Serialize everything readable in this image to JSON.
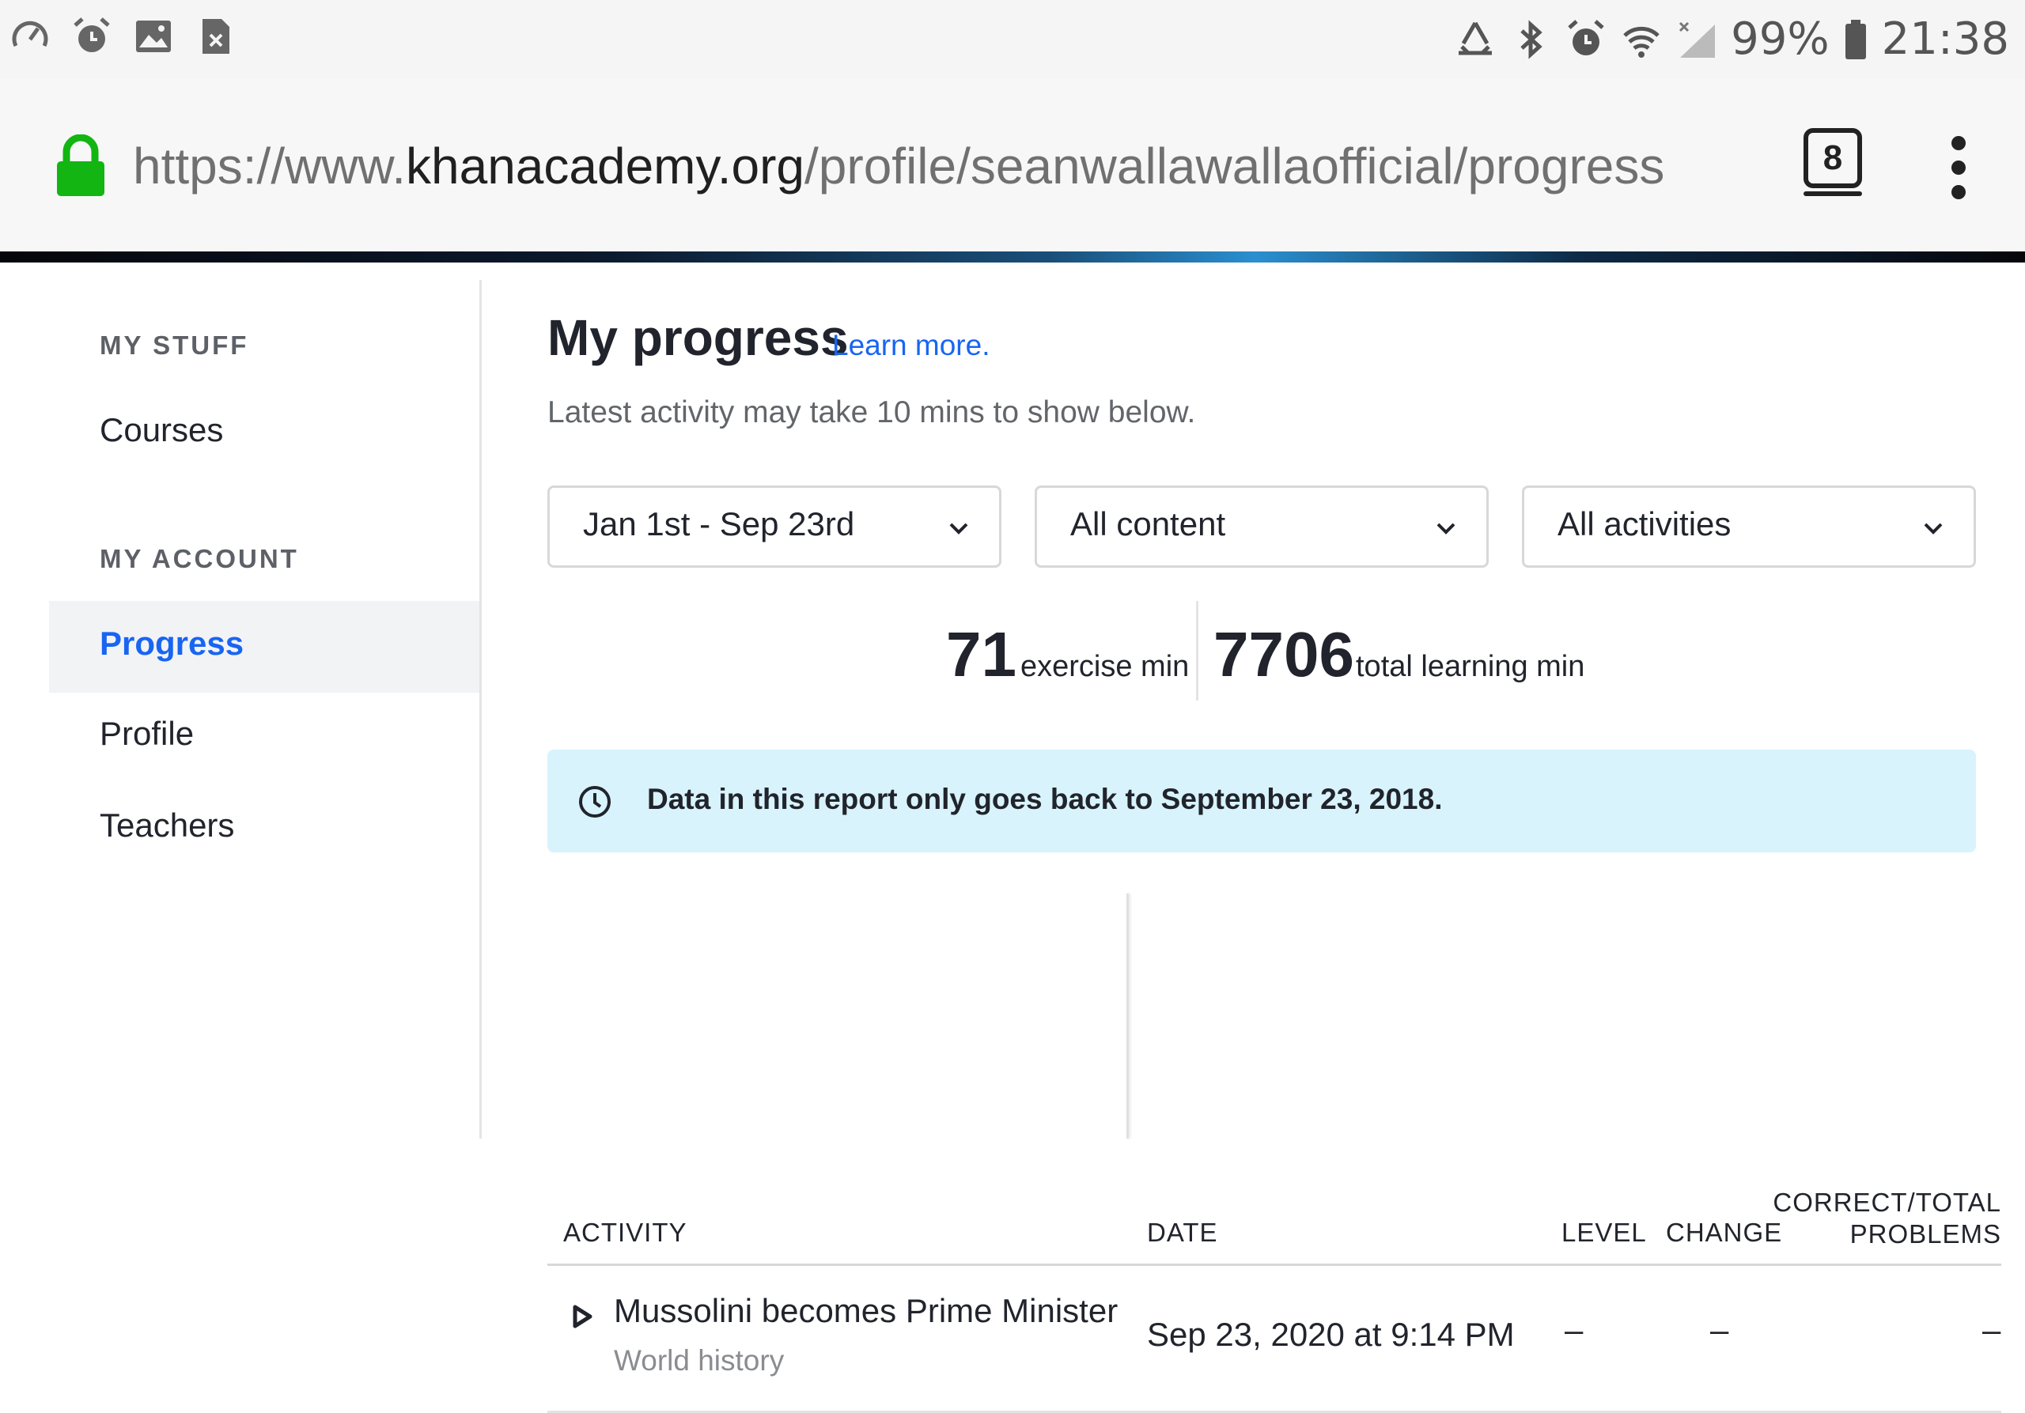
{
  "status_bar": {
    "battery": "99%",
    "time": "21:38",
    "left_icons": [
      "speedometer-icon",
      "alarm-icon",
      "image-icon",
      "close-box-icon"
    ],
    "right_icons": [
      "recycle-icon",
      "bluetooth-icon",
      "alarm-icon",
      "wifi-icon",
      "signal-icon",
      "battery-icon"
    ]
  },
  "browser": {
    "url_scheme": "https://www.",
    "url_host": "khanacademy.org",
    "url_path": "/profile/seanwallawallaofficial/progress",
    "tab_count": "8"
  },
  "sidebar": {
    "my_stuff_heading": "MY STUFF",
    "courses": "Courses",
    "my_account_heading": "MY ACCOUNT",
    "progress": "Progress",
    "profile": "Profile",
    "teachers": "Teachers"
  },
  "main": {
    "title": "My progress",
    "learn_more": "Learn more.",
    "subtitle": "Latest activity may take 10 mins to show below.",
    "filters": {
      "date_range": "Jan 1st - Sep 23rd",
      "content": "All content",
      "activities": "All activities"
    },
    "stats": {
      "exercise_value": "71",
      "exercise_label": "exercise min",
      "total_value": "7706",
      "total_label": "total learning min"
    },
    "banner": "Data in this report only goes back to September 23, 2018.",
    "table": {
      "headers": {
        "activity": "ACTIVITY",
        "date": "DATE",
        "level": "LEVEL",
        "change": "CHANGE",
        "correct_line1": "CORRECT/TOTAL",
        "correct_line2": "PROBLEMS"
      },
      "rows": [
        {
          "title": "Mussolini becomes Prime Minister",
          "subject": "World history",
          "date": "Sep 23, 2020 at 9:14 PM",
          "level": "–",
          "change": "–",
          "correct": "–"
        }
      ]
    }
  }
}
